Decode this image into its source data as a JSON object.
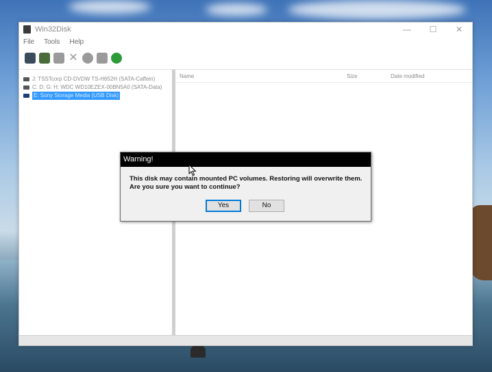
{
  "window": {
    "title": "Win32Disk",
    "menu": [
      "File",
      "Tools",
      "Help"
    ],
    "tree_items": [
      {
        "label": "J: TSSTcorp CD-DVDW TS-H652H (SATA-Caffein)",
        "selected": false
      },
      {
        "label": "C: D: G: H: WDC WD10EZEX-00BN5A0 (SATA-Data)",
        "selected": false
      },
      {
        "label": "E: Sony Storage Media (USB Disk)",
        "selected": true
      }
    ],
    "columns": {
      "name": "Name",
      "size": "Size",
      "date": "Date modified"
    }
  },
  "dialog": {
    "title": "Warning!",
    "line1": "This disk may contain mounted PC volumes. Restoring will overwrite them.",
    "line2": "Are you sure you want to continue?",
    "yes": "Yes",
    "no": "No"
  },
  "colors": {
    "selection": "#3399ff",
    "dialog_title_bg": "#000000",
    "default_button_border": "#0078d7"
  }
}
